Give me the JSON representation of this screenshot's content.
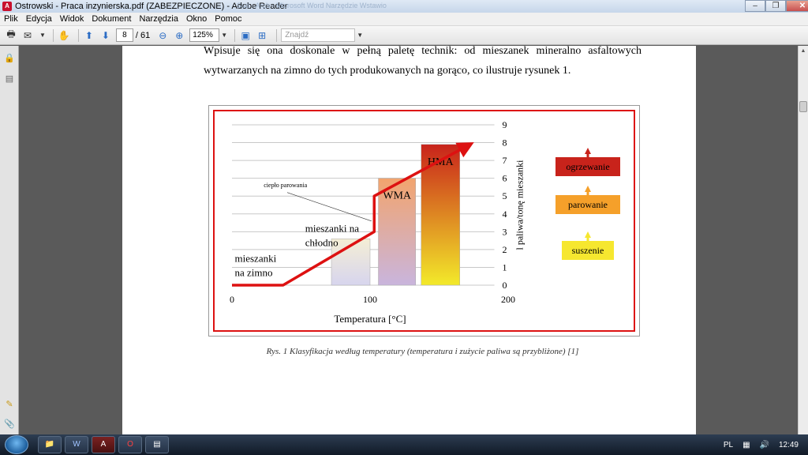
{
  "window": {
    "title": "Ostrowski - Praca inzynierska.pdf (ZABEZPIECZONE) - Adobe Reader",
    "background_window_title": "Sud - Arch - Microsoft Word     Narzędzie Wstawio",
    "controls": {
      "minimize": "–",
      "restore": "❐",
      "close": "✕"
    }
  },
  "menu": [
    "Plik",
    "Edycja",
    "Widok",
    "Dokument",
    "Narzędzia",
    "Okno",
    "Pomoc"
  ],
  "toolbar": {
    "page_current": "8",
    "page_total": "/ 61",
    "zoom": "125%",
    "find_placeholder": "Znajdź",
    "icons": [
      "print-icon",
      "email-icon",
      "hand-icon",
      "arrow-up-icon",
      "arrow-down-icon",
      "zoom-out-icon",
      "zoom-in-icon",
      "fit-page-icon",
      "fit-width-icon"
    ]
  },
  "document": {
    "paragraph": "Wpisuje się ona doskonale w pełną paletę technik: od mieszanek mineralno asfaltowych wytwarzanych na zimno do tych produkowanych na gorąco, co ilustruje rysunek 1.",
    "caption": "Rys. 1 Klasyfikacja według temperatury (temperatura i zużycie paliwa są przybliżone) [1]"
  },
  "chart_data": {
    "type": "bar",
    "xlabel": "Temperatura [°C]",
    "ylabel": "l paliwa/tonę mieszanki",
    "x_ticks": [
      "0",
      "100",
      "200"
    ],
    "y_ticks": [
      "0",
      "1",
      "2",
      "3",
      "4",
      "5",
      "6",
      "7",
      "8",
      "9"
    ],
    "xlim": [
      0,
      200
    ],
    "ylim": [
      0,
      9
    ],
    "grid": true,
    "bars": [
      {
        "label": "",
        "x_start": 72,
        "x_end": 100,
        "value": 2.6,
        "colors": [
          "#f4eed5",
          "#d7d5ee"
        ]
      },
      {
        "label": "WMA",
        "x_start": 106,
        "x_end": 133,
        "value": 6.0,
        "colors": [
          "#f2a46e",
          "#c9b5dd"
        ]
      },
      {
        "label": "HMA",
        "x_start": 137,
        "x_end": 165,
        "value": 7.9,
        "colors": [
          "#c8231b",
          "#f3ea2a"
        ]
      }
    ],
    "trend_line": [
      {
        "x": 0,
        "y": 0
      },
      {
        "x": 37,
        "y": 0
      },
      {
        "x": 103,
        "y": 3.0
      },
      {
        "x": 103,
        "y": 5.0
      },
      {
        "x": 170,
        "y": 7.8
      }
    ],
    "labels": [
      {
        "text": "mieszanki",
        "x": 2,
        "y": 1.3
      },
      {
        "text": "na zimno",
        "x": 2,
        "y": 0.5
      },
      {
        "text": "mieszanki na",
        "x": 53,
        "y": 3.0
      },
      {
        "text": "chłodno",
        "x": 53,
        "y": 2.2
      },
      {
        "text": "ciepło parowania",
        "x": 23,
        "y": 5.5
      }
    ],
    "legend_boxes": [
      {
        "text": "ogrzewanie",
        "color": "#c8231b"
      },
      {
        "text": "parowanie",
        "color": "#f5a02a"
      },
      {
        "text": "suszenie",
        "color": "#f6e72f"
      }
    ]
  },
  "taskbar": {
    "buttons": [
      "explorer-icon",
      "word-icon",
      "acrobat-icon",
      "opera-icon",
      "notepad-icon"
    ],
    "language": "PL",
    "clock": "12:49"
  }
}
